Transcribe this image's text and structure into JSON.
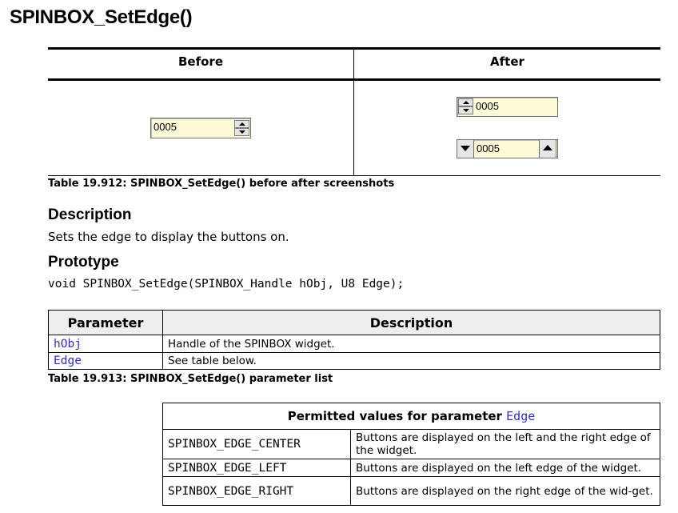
{
  "title": "SPINBOX_SetEdge()",
  "screenshot_table": {
    "before_header": "Before",
    "after_header": "After",
    "before_spinbox_value": "0005",
    "after_spinbox_top_value": "0005",
    "after_spinbox_bottom_value": "0005",
    "caption": "Table 19.912: SPINBOX_SetEdge() before after screenshots"
  },
  "description": {
    "heading": "Description",
    "text": "Sets the edge to display the buttons on."
  },
  "prototype": {
    "heading": "Prototype",
    "code": "void SPINBOX_SetEdge(SPINBOX_Handle hObj, U8 Edge);"
  },
  "parameter_table": {
    "col_parameter": "Parameter",
    "col_description": "Description",
    "rows": [
      {
        "name": "hObj",
        "description": "Handle of the SPINBOX widget."
      },
      {
        "name": "Edge",
        "description": "See table below."
      }
    ],
    "caption": "Table 19.913: SPINBOX_SetEdge() parameter list"
  },
  "values_table": {
    "header_prefix": "Permitted values for parameter ",
    "header_param": "Edge",
    "rows": [
      {
        "name": "SPINBOX_EDGE_CENTER",
        "description": "Buttons are displayed on the left and the right edge of the widget."
      },
      {
        "name": "SPINBOX_EDGE_LEFT",
        "description": "Buttons are displayed on the left edge of the widget."
      },
      {
        "name": "SPINBOX_EDGE_RIGHT",
        "description": "Buttons are displayed on the right edge of the wid-get."
      }
    ]
  },
  "colors": {
    "link_blue": "#2f2fc8",
    "spinbox_fill": "#fffbd8",
    "header_gray": "#eeeeee"
  }
}
